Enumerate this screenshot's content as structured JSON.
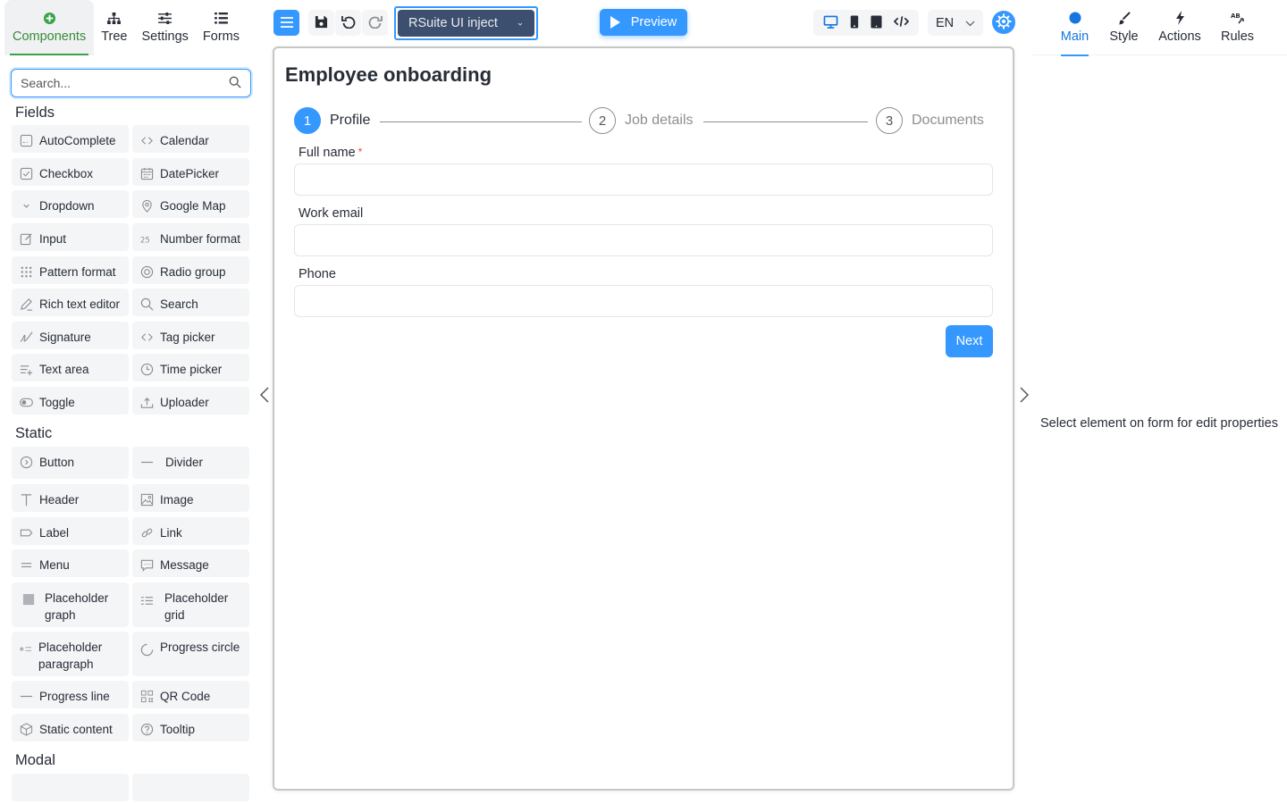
{
  "left_tabs": [
    {
      "label": "Components",
      "icon": "plus-circle-icon"
    },
    {
      "label": "Tree",
      "icon": "sitemap-icon"
    },
    {
      "label": "Settings",
      "icon": "sliders-icon"
    },
    {
      "label": "Forms",
      "icon": "list-icon"
    }
  ],
  "search": {
    "placeholder": "Search..."
  },
  "sections": {
    "fields": "Fields",
    "static": "Static",
    "modal": "Modal"
  },
  "fields_items": [
    {
      "label": "AutoComplete",
      "icon": "autocomplete-icon"
    },
    {
      "label": "Calendar",
      "icon": "code-brackets-icon"
    },
    {
      "label": "Checkbox",
      "icon": "checkbox-icon"
    },
    {
      "label": "DatePicker",
      "icon": "calendar-icon"
    },
    {
      "label": "Dropdown",
      "icon": "chevron-down-icon"
    },
    {
      "label": "Google Map",
      "icon": "map-pin-icon"
    },
    {
      "label": "Input",
      "icon": "edit-icon"
    },
    {
      "label": "Number format",
      "icon": "number-icon"
    },
    {
      "label": "Pattern format",
      "icon": "dots-grid-icon"
    },
    {
      "label": "Radio group",
      "icon": "radio-icon"
    },
    {
      "label": "Rich text editor",
      "icon": "pencil-icon"
    },
    {
      "label": "Search",
      "icon": "search-icon"
    },
    {
      "label": "Signature",
      "icon": "signature-icon"
    },
    {
      "label": "Tag picker",
      "icon": "code-brackets-icon"
    },
    {
      "label": "Text area",
      "icon": "text-area-icon"
    },
    {
      "label": "Time picker",
      "icon": "clock-icon"
    },
    {
      "label": "Toggle",
      "icon": "toggle-icon"
    },
    {
      "label": "Uploader",
      "icon": "upload-icon"
    }
  ],
  "static_items": [
    {
      "label": "Button",
      "icon": "button-icon"
    },
    {
      "label": "Divider",
      "icon": "divider-icon"
    },
    {
      "label": "Header",
      "icon": "header-t-icon"
    },
    {
      "label": "Image",
      "icon": "image-icon"
    },
    {
      "label": "Label",
      "icon": "label-tag-icon"
    },
    {
      "label": "Link",
      "icon": "link-icon"
    },
    {
      "label": "Menu",
      "icon": "menu-lines-icon"
    },
    {
      "label": "Message",
      "icon": "message-icon"
    },
    {
      "label": "Placeholder graph",
      "icon": "square-icon"
    },
    {
      "label": "Placeholder grid",
      "icon": "grid-lines-icon"
    },
    {
      "label": "Placeholder paragraph",
      "icon": "paragraph-icon"
    },
    {
      "label": "Progress circle",
      "icon": "progress-circle-icon"
    },
    {
      "label": "Progress line",
      "icon": "progress-line-icon"
    },
    {
      "label": "QR Code",
      "icon": "qr-code-icon"
    },
    {
      "label": "Static content",
      "icon": "cube-icon"
    },
    {
      "label": "Tooltip",
      "icon": "question-circle-icon"
    }
  ],
  "toolbar": {
    "theme": "RSuite UI inject",
    "preview": "Preview",
    "language": "EN"
  },
  "form": {
    "title": "Employee onboarding",
    "steps": [
      {
        "number": "1",
        "label": "Profile",
        "active": true
      },
      {
        "number": "2",
        "label": "Job details",
        "active": false
      },
      {
        "number": "3",
        "label": "Documents",
        "active": false
      }
    ],
    "fields": [
      {
        "label": "Full name",
        "required": true,
        "value": ""
      },
      {
        "label": "Work email",
        "required": false,
        "value": ""
      },
      {
        "label": "Phone",
        "required": false,
        "value": ""
      }
    ],
    "required_mark": "*",
    "next": "Next"
  },
  "right_tabs": [
    {
      "label": "Main",
      "icon": "dot-icon"
    },
    {
      "label": "Style",
      "icon": "brush-icon"
    },
    {
      "label": "Actions",
      "icon": "bolt-icon"
    },
    {
      "label": "Rules",
      "icon": "ab-rules-icon"
    }
  ],
  "right_hint": "Select element on form for edit properties",
  "colors": {
    "accent": "#3498ff",
    "components_tab": "#3a8a3a",
    "theme_select_bg": "#3c4f6e"
  }
}
